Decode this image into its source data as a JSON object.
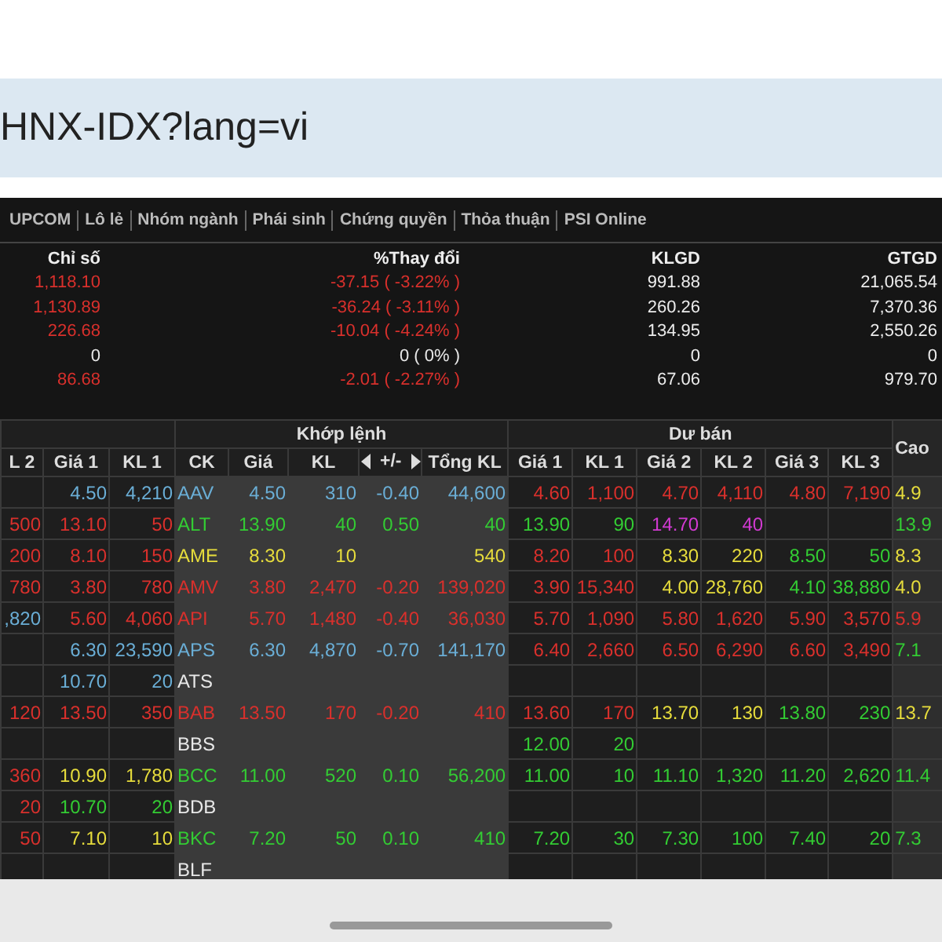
{
  "address_bar": {
    "url": "HNX-IDX?lang=vi"
  },
  "tabs": [
    "UPCOM",
    "Lô lẻ",
    "Nhóm ngành",
    "Phái sinh",
    "Chứng quyền",
    "Thỏa thuận",
    "PSI Online"
  ],
  "index_table": {
    "columns": [
      "Chỉ số",
      "%Thay đổi",
      "KLGD",
      "GTGD"
    ],
    "rows": [
      {
        "color": "#d9302c",
        "values": [
          "1,118.10",
          "-37.15 ( -3.22% )",
          "991.88",
          "21,065.54"
        ]
      },
      {
        "color": "#d9302c",
        "values": [
          "1,130.89",
          "-36.24 ( -3.11% )",
          "260.26",
          "7,370.36"
        ]
      },
      {
        "color": "#d9302c",
        "values": [
          "226.68",
          "-10.04 ( -4.24% )",
          "134.95",
          "2,550.26"
        ]
      },
      {
        "color": "#e8e8e8",
        "values": [
          "0",
          "0 ( 0% )",
          "0",
          "0"
        ]
      },
      {
        "color": "#d9302c",
        "values": [
          "86.68",
          "-2.01 ( -2.27% )",
          "67.06",
          "979.70"
        ]
      }
    ]
  },
  "board": {
    "groups": [
      {
        "columns": [
          {
            "label": "L 2",
            "kind": "plain"
          },
          {
            "label": "Giá 1",
            "kind": "plain"
          },
          {
            "label": "KL 1",
            "kind": "plain"
          }
        ]
      },
      {
        "label": "Khớp lệnh",
        "columns": [
          {
            "label": "CK",
            "kind": "plain"
          },
          {
            "label": "Giá",
            "kind": "plain"
          },
          {
            "label": "KL",
            "kind": "plain"
          },
          {
            "label": "+/-",
            "kind": "paged"
          },
          {
            "label": "Tổng KL",
            "kind": "plain"
          }
        ]
      },
      {
        "label": "Dư bán",
        "columns": [
          {
            "label": "Giá 1",
            "kind": "plain"
          },
          {
            "label": "KL 1",
            "kind": "plain"
          },
          {
            "label": "Giá 2",
            "kind": "plain"
          },
          {
            "label": "KL 2",
            "kind": "plain"
          },
          {
            "label": "Giá 3",
            "kind": "plain"
          },
          {
            "label": "KL 3",
            "kind": "plain"
          }
        ]
      },
      {
        "label": "Cao"
      }
    ],
    "rows": [
      {
        "cells": [
          null,
          {
            "text": "4.50",
            "color": "#6aaed6"
          },
          {
            "text": "4,210",
            "color": "#6aaed6"
          },
          {
            "text": "AAV",
            "color": "#6aaed6"
          },
          {
            "text": "4.50",
            "color": "#6aaed6"
          },
          {
            "text": "310",
            "color": "#6aaed6"
          },
          {
            "text": "-0.40",
            "color": "#6aaed6"
          },
          {
            "text": "44,600",
            "color": "#6aaed6"
          },
          {
            "text": "4.60",
            "color": "#d9302c"
          },
          {
            "text": "1,100",
            "color": "#d9302c"
          },
          {
            "text": "4.70",
            "color": "#d9302c"
          },
          {
            "text": "4,110",
            "color": "#d9302c"
          },
          {
            "text": "4.80",
            "color": "#d9302c"
          },
          {
            "text": "7,190",
            "color": "#d9302c"
          },
          {
            "text": "4.9",
            "color": "#e6dc3c"
          }
        ]
      },
      {
        "cells": [
          {
            "text": "500",
            "color": "#d9302c"
          },
          {
            "text": "13.10",
            "color": "#d9302c"
          },
          {
            "text": "50",
            "color": "#d9302c"
          },
          {
            "text": "ALT",
            "color": "#33cc33"
          },
          {
            "text": "13.90",
            "color": "#33cc33"
          },
          {
            "text": "40",
            "color": "#33cc33"
          },
          {
            "text": "0.50",
            "color": "#33cc33"
          },
          {
            "text": "40",
            "color": "#33cc33"
          },
          {
            "text": "13.90",
            "color": "#33cc33"
          },
          {
            "text": "90",
            "color": "#33cc33"
          },
          {
            "text": "14.70",
            "color": "#d23ad2"
          },
          {
            "text": "40",
            "color": "#d23ad2"
          },
          null,
          null,
          {
            "text": "13.9",
            "color": "#33cc33"
          }
        ]
      },
      {
        "cells": [
          {
            "text": "200",
            "color": "#d9302c"
          },
          {
            "text": "8.10",
            "color": "#d9302c"
          },
          {
            "text": "150",
            "color": "#d9302c"
          },
          {
            "text": "AME",
            "color": "#e6dc3c"
          },
          {
            "text": "8.30",
            "color": "#e6dc3c"
          },
          {
            "text": "10",
            "color": "#e6dc3c"
          },
          null,
          {
            "text": "540",
            "color": "#e6dc3c"
          },
          {
            "text": "8.20",
            "color": "#d9302c"
          },
          {
            "text": "100",
            "color": "#d9302c"
          },
          {
            "text": "8.30",
            "color": "#e6dc3c"
          },
          {
            "text": "220",
            "color": "#e6dc3c"
          },
          {
            "text": "8.50",
            "color": "#33cc33"
          },
          {
            "text": "50",
            "color": "#33cc33"
          },
          {
            "text": "8.3",
            "color": "#e6dc3c"
          }
        ]
      },
      {
        "cells": [
          {
            "text": "780",
            "color": "#d9302c"
          },
          {
            "text": "3.80",
            "color": "#d9302c"
          },
          {
            "text": "780",
            "color": "#d9302c"
          },
          {
            "text": "AMV",
            "color": "#d9302c"
          },
          {
            "text": "3.80",
            "color": "#d9302c"
          },
          {
            "text": "2,470",
            "color": "#d9302c"
          },
          {
            "text": "-0.20",
            "color": "#d9302c"
          },
          {
            "text": "139,020",
            "color": "#d9302c"
          },
          {
            "text": "3.90",
            "color": "#d9302c"
          },
          {
            "text": "15,340",
            "color": "#d9302c"
          },
          {
            "text": "4.00",
            "color": "#e6dc3c"
          },
          {
            "text": "28,760",
            "color": "#e6dc3c"
          },
          {
            "text": "4.10",
            "color": "#33cc33"
          },
          {
            "text": "38,880",
            "color": "#33cc33"
          },
          {
            "text": "4.0",
            "color": "#e6dc3c"
          }
        ]
      },
      {
        "cells": [
          {
            "text": ",820",
            "color": "#6aaed6"
          },
          {
            "text": "5.60",
            "color": "#d9302c"
          },
          {
            "text": "4,060",
            "color": "#d9302c"
          },
          {
            "text": "API",
            "color": "#d9302c"
          },
          {
            "text": "5.70",
            "color": "#d9302c"
          },
          {
            "text": "1,480",
            "color": "#d9302c"
          },
          {
            "text": "-0.40",
            "color": "#d9302c"
          },
          {
            "text": "36,030",
            "color": "#d9302c"
          },
          {
            "text": "5.70",
            "color": "#d9302c"
          },
          {
            "text": "1,090",
            "color": "#d9302c"
          },
          {
            "text": "5.80",
            "color": "#d9302c"
          },
          {
            "text": "1,620",
            "color": "#d9302c"
          },
          {
            "text": "5.90",
            "color": "#d9302c"
          },
          {
            "text": "3,570",
            "color": "#d9302c"
          },
          {
            "text": "5.9",
            "color": "#d9302c"
          }
        ]
      },
      {
        "cells": [
          null,
          {
            "text": "6.30",
            "color": "#6aaed6"
          },
          {
            "text": "23,590",
            "color": "#6aaed6"
          },
          {
            "text": "APS",
            "color": "#6aaed6"
          },
          {
            "text": "6.30",
            "color": "#6aaed6"
          },
          {
            "text": "4,870",
            "color": "#6aaed6"
          },
          {
            "text": "-0.70",
            "color": "#6aaed6"
          },
          {
            "text": "141,170",
            "color": "#6aaed6"
          },
          {
            "text": "6.40",
            "color": "#d9302c"
          },
          {
            "text": "2,660",
            "color": "#d9302c"
          },
          {
            "text": "6.50",
            "color": "#d9302c"
          },
          {
            "text": "6,290",
            "color": "#d9302c"
          },
          {
            "text": "6.60",
            "color": "#d9302c"
          },
          {
            "text": "3,490",
            "color": "#d9302c"
          },
          {
            "text": "7.1",
            "color": "#33cc33"
          }
        ]
      },
      {
        "cells": [
          null,
          {
            "text": "10.70",
            "color": "#6aaed6"
          },
          {
            "text": "20",
            "color": "#6aaed6"
          },
          {
            "text": "ATS",
            "color": "#e8e8e8"
          },
          null,
          null,
          null,
          null,
          null,
          null,
          null,
          null,
          null,
          null,
          null
        ]
      },
      {
        "cells": [
          {
            "text": "120",
            "color": "#d9302c"
          },
          {
            "text": "13.50",
            "color": "#d9302c"
          },
          {
            "text": "350",
            "color": "#d9302c"
          },
          {
            "text": "BAB",
            "color": "#d9302c"
          },
          {
            "text": "13.50",
            "color": "#d9302c"
          },
          {
            "text": "170",
            "color": "#d9302c"
          },
          {
            "text": "-0.20",
            "color": "#d9302c"
          },
          {
            "text": "410",
            "color": "#d9302c"
          },
          {
            "text": "13.60",
            "color": "#d9302c"
          },
          {
            "text": "170",
            "color": "#d9302c"
          },
          {
            "text": "13.70",
            "color": "#e6dc3c"
          },
          {
            "text": "130",
            "color": "#e6dc3c"
          },
          {
            "text": "13.80",
            "color": "#33cc33"
          },
          {
            "text": "230",
            "color": "#33cc33"
          },
          {
            "text": "13.7",
            "color": "#e6dc3c"
          }
        ]
      },
      {
        "cells": [
          null,
          null,
          null,
          {
            "text": "BBS",
            "color": "#e8e8e8"
          },
          null,
          null,
          null,
          null,
          {
            "text": "12.00",
            "color": "#33cc33"
          },
          {
            "text": "20",
            "color": "#33cc33"
          },
          null,
          null,
          null,
          null,
          null
        ]
      },
      {
        "cells": [
          {
            "text": "360",
            "color": "#d9302c"
          },
          {
            "text": "10.90",
            "color": "#e6dc3c"
          },
          {
            "text": "1,780",
            "color": "#e6dc3c"
          },
          {
            "text": "BCC",
            "color": "#33cc33"
          },
          {
            "text": "11.00",
            "color": "#33cc33"
          },
          {
            "text": "520",
            "color": "#33cc33"
          },
          {
            "text": "0.10",
            "color": "#33cc33"
          },
          {
            "text": "56,200",
            "color": "#33cc33"
          },
          {
            "text": "11.00",
            "color": "#33cc33"
          },
          {
            "text": "10",
            "color": "#33cc33"
          },
          {
            "text": "11.10",
            "color": "#33cc33"
          },
          {
            "text": "1,320",
            "color": "#33cc33"
          },
          {
            "text": "11.20",
            "color": "#33cc33"
          },
          {
            "text": "2,620",
            "color": "#33cc33"
          },
          {
            "text": "11.4",
            "color": "#33cc33"
          }
        ]
      },
      {
        "cells": [
          {
            "text": "20",
            "color": "#d9302c"
          },
          {
            "text": "10.70",
            "color": "#33cc33"
          },
          {
            "text": "20",
            "color": "#33cc33"
          },
          {
            "text": "BDB",
            "color": "#e8e8e8"
          },
          null,
          null,
          null,
          null,
          null,
          null,
          null,
          null,
          null,
          null,
          null
        ]
      },
      {
        "cells": [
          {
            "text": "50",
            "color": "#d9302c"
          },
          {
            "text": "7.10",
            "color": "#e6dc3c"
          },
          {
            "text": "10",
            "color": "#e6dc3c"
          },
          {
            "text": "BKC",
            "color": "#33cc33"
          },
          {
            "text": "7.20",
            "color": "#33cc33"
          },
          {
            "text": "50",
            "color": "#33cc33"
          },
          {
            "text": "0.10",
            "color": "#33cc33"
          },
          {
            "text": "410",
            "color": "#33cc33"
          },
          {
            "text": "7.20",
            "color": "#33cc33"
          },
          {
            "text": "30",
            "color": "#33cc33"
          },
          {
            "text": "7.30",
            "color": "#33cc33"
          },
          {
            "text": "100",
            "color": "#33cc33"
          },
          {
            "text": "7.40",
            "color": "#33cc33"
          },
          {
            "text": "20",
            "color": "#33cc33"
          },
          {
            "text": "7.3",
            "color": "#33cc33"
          }
        ]
      },
      {
        "cells": [
          null,
          null,
          null,
          {
            "text": "BLF",
            "color": "#e8e8e8"
          },
          null,
          null,
          null,
          null,
          null,
          null,
          null,
          null,
          null,
          null,
          null
        ]
      }
    ]
  }
}
